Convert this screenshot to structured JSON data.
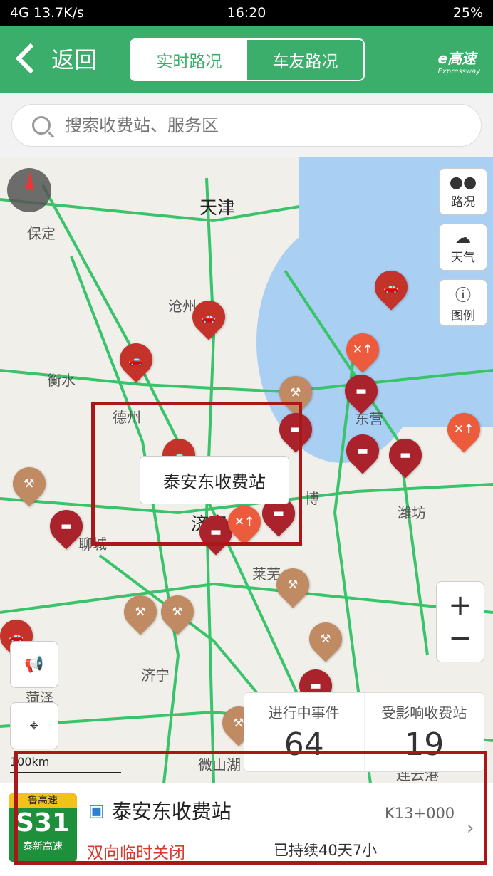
{
  "status_bar": {
    "left": "4G 13.7K/s",
    "time": "16:20",
    "battery": "25%"
  },
  "header": {
    "back_label": "返回",
    "tabs": [
      "实时路况",
      "车友路况"
    ],
    "active_tab": 1,
    "logo": "e高速",
    "logo_sub": "Expressway"
  },
  "search": {
    "placeholder": "搜索收费站、服务区"
  },
  "map": {
    "cities": [
      "天津",
      "保定",
      "沧州",
      "衡水",
      "德州",
      "东营",
      "博",
      "潍坊",
      "济南",
      "聊城",
      "莱芜",
      "济宁",
      "菏泽",
      "微山湖",
      "连云港"
    ],
    "controls": [
      "路况",
      "天气",
      "图例"
    ],
    "callout": "泰安东收费站",
    "scale": "100km",
    "stats": {
      "ongoing_label": "进行中事件",
      "ongoing_value": "64",
      "affected_label": "受影响收费站",
      "affected_value": "19"
    }
  },
  "card": {
    "route_region": "鲁高速",
    "route_code": "S31",
    "route_name": "泰新高速",
    "station": "泰安东收费站",
    "status": "双向临时关闭",
    "km": "K13+000",
    "duration": "已持续40天7小"
  },
  "colors": {
    "brand": "#3cae6b",
    "alert": "#d83a2c",
    "highlight": "#a81818"
  }
}
